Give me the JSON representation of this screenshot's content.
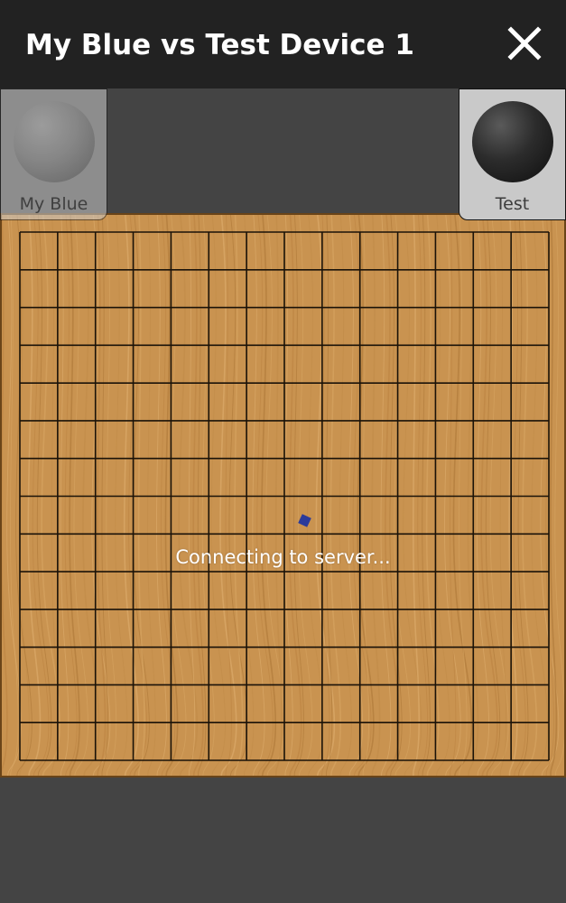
{
  "header": {
    "title": "My Blue vs Test Device 1",
    "close_icon": "close-icon"
  },
  "players": {
    "left": {
      "name": "My Blue",
      "stone_color": "white",
      "active": false
    },
    "right": {
      "name": "Test",
      "stone_color": "black",
      "active": true
    }
  },
  "board": {
    "lines": 15,
    "color": "#c99350"
  },
  "status": {
    "text": "Connecting to server...",
    "spinner_color": "#2a3a9a"
  }
}
